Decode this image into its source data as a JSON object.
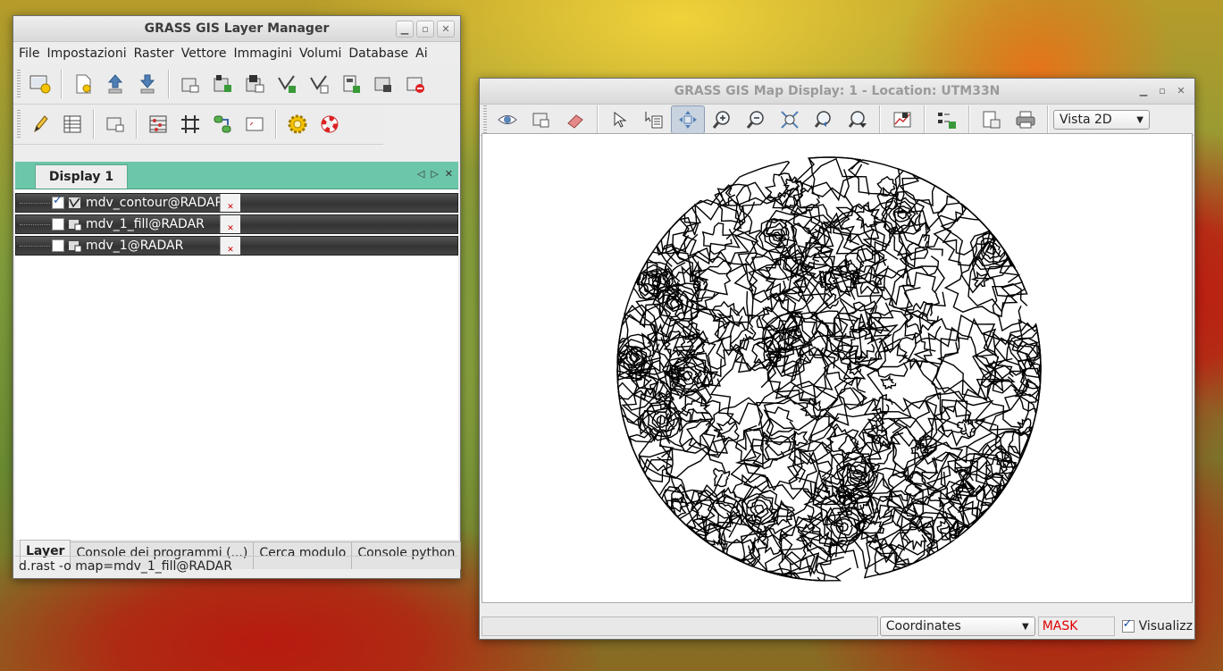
{
  "layer_manager": {
    "title": "GRASS GIS Layer Manager",
    "menu": [
      "File",
      "Impostazioni",
      "Raster",
      "Vettore",
      "Immagini",
      "Volumi",
      "Database",
      "Ai"
    ],
    "display_tab": "Display 1",
    "layers": [
      {
        "name": "mdv_contour@RADAR",
        "checked": true,
        "type": "vector"
      },
      {
        "name": "mdv_1_fill@RADAR",
        "checked": false,
        "type": "raster"
      },
      {
        "name": "mdv_1@RADAR",
        "checked": false,
        "type": "raster"
      }
    ],
    "bottom_tabs": [
      "Layer",
      "Console dei programmi (...)",
      "Cerca modulo",
      "Console python"
    ],
    "status": "d.rast -o map=mdv_1_fill@RADAR"
  },
  "map_display": {
    "title": "GRASS GIS Map Display: 1  - Location: UTM33N",
    "view_select": "Vista 2D",
    "coords_select": "Coordinates",
    "mask_label": "MASK",
    "render_label": "Visualizz",
    "render_checked": true,
    "mask_color": "#e00000"
  },
  "colors": {
    "tab_strip": "#6cc6a9",
    "layer_row": "#3d3d3d"
  }
}
